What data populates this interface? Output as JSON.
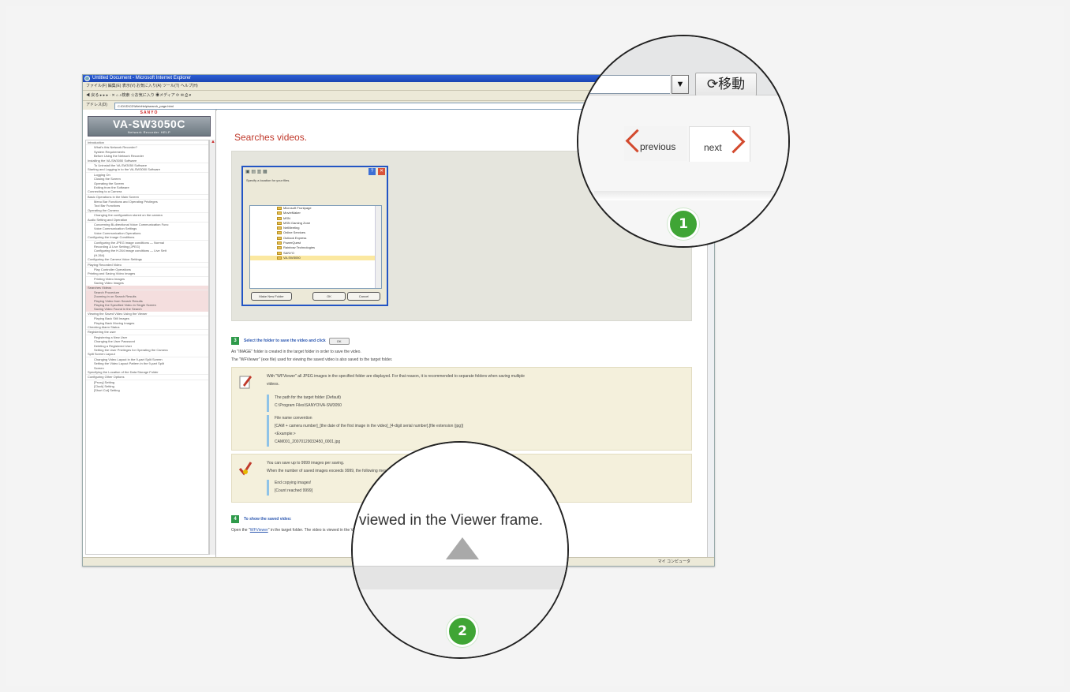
{
  "browser": {
    "title": "Untitled Document - Microsoft Internet Explorer",
    "menu": "ファイル(F)   編集(E)   表示(V)   お気に入り(A)   ツール(T)   ヘルプ(H)",
    "toolbar": "◀ 戻る ▸ ▸ ▸ · ✕ ⌂ ⌕検索 ☆お気に入り ◉メディア ⟳ ✉ ⎙ ▾",
    "address_label": "アドレス(D)",
    "address": "C:\\DVD\\CD\\WebHelp\\search_page.html",
    "status_zone": "マイ コンピュータ"
  },
  "sidebar": {
    "brand": "SANYO",
    "model": "VA-SW3050C",
    "model_sub": "Network Recorder HELP",
    "toc": [
      {
        "t": "Introduction",
        "level": 0
      },
      {
        "t": "What's this Network Recorder?",
        "level": 1
      },
      {
        "t": "System Requirements",
        "level": 1
      },
      {
        "t": "Before Using the Network Recorder",
        "level": 1
      },
      {
        "t": "Installing the VA-SW3050 Software",
        "level": 0
      },
      {
        "t": "To Uninstall the VA-SW3050 Software",
        "level": 1
      },
      {
        "t": "Starting and Logging in to the VA-SW3050 Software",
        "level": 0
      },
      {
        "t": "Logging On",
        "level": 1
      },
      {
        "t": "Closing the Screen",
        "level": 1
      },
      {
        "t": "Operating the Screen",
        "level": 1
      },
      {
        "t": "Exiting from the Software",
        "level": 1
      },
      {
        "t": "Connecting to a Camera",
        "level": 0
      },
      {
        "t": "Basic Operations in the Main Screen",
        "level": 0
      },
      {
        "t": "Menu Bar Functions and Operating Privileges",
        "level": 1
      },
      {
        "t": "Tool Bar Functions",
        "level": 1
      },
      {
        "t": "Operating the Camera",
        "level": 0
      },
      {
        "t": "Changing the configuration stored on the camera",
        "level": 1
      },
      {
        "t": "Audio Setting and Operation",
        "level": 0
      },
      {
        "t": "Concerning Bi-directional Voice Communication Func",
        "level": 1
      },
      {
        "t": "Voice Communication Settings",
        "level": 1
      },
      {
        "t": "Voice Communication Operations",
        "level": 1
      },
      {
        "t": "Configuring the Image Conditions",
        "level": 0
      },
      {
        "t": "Configuring the JPEG image conditions — Normal",
        "level": 1
      },
      {
        "t": "Recording & Live Setting (JPEG)",
        "level": 1
      },
      {
        "t": "Configuring the H.264 image conditions — Live Sett",
        "level": 1
      },
      {
        "t": "(H.264)",
        "level": 1
      },
      {
        "t": "Configuring the Camera Voice Settings",
        "level": 0
      },
      {
        "t": "Playing Recorded Video",
        "level": 0
      },
      {
        "t": "Play Controller Operations",
        "level": 1
      },
      {
        "t": "Printing and Saving Video Images",
        "level": 0
      },
      {
        "t": "Printing Video Images",
        "level": 1
      },
      {
        "t": "Saving Video Images",
        "level": 1
      },
      {
        "t": "Searches Videos",
        "level": 0,
        "hl": true
      },
      {
        "t": "Search Procedure",
        "level": 1,
        "hl": true
      },
      {
        "t": "Zooming in on Search Results",
        "level": 1,
        "hl": true
      },
      {
        "t": "Playing Video from Search Results",
        "level": 1,
        "hl": true
      },
      {
        "t": "Playing the Specified Video in Single Screen",
        "level": 1,
        "hl": true
      },
      {
        "t": "Saving Video Found in the Search",
        "level": 1,
        "hl": true
      },
      {
        "t": "Viewing the Saved Video Using the Viewer",
        "level": 0
      },
      {
        "t": "Playing Back Still Images",
        "level": 1
      },
      {
        "t": "Playing Back Moving Images",
        "level": 1
      },
      {
        "t": "Checking Alarm Status",
        "level": 0
      },
      {
        "t": "Registering the user",
        "level": 0
      },
      {
        "t": "Registering a New User",
        "level": 1
      },
      {
        "t": "Changing the User Password",
        "level": 1
      },
      {
        "t": "Deleting a Registered User",
        "level": 1
      },
      {
        "t": "Setting the User Privileges for Operating the Camera",
        "level": 1
      },
      {
        "t": "Split Screen Layout",
        "level": 0
      },
      {
        "t": "Changing Video Layout in the 9-part Split Screen",
        "level": 1
      },
      {
        "t": "Setting the Video Layout Pattern in the 9-part Split",
        "level": 1
      },
      {
        "t": "Screen",
        "level": 1
      },
      {
        "t": "Specifying the Location of the Data Storage Folder",
        "level": 0
      },
      {
        "t": "Configuring Other Options",
        "level": 0
      },
      {
        "t": "[Proxy] Setting",
        "level": 1
      },
      {
        "t": "[Clock] Setting",
        "level": 1
      },
      {
        "t": "[Short Cut] Setting",
        "level": 1
      }
    ]
  },
  "main": {
    "heading": "Searches videos.",
    "dialog": {
      "prompt": "Specify a location for your files.",
      "folders": [
        "Microsoft Frontpage",
        "MovieMaker",
        "MSN",
        "MSN Gaming Zone",
        "NetMeeting",
        "Online Services",
        "Outlook Express",
        "PowerQuest",
        "Rainbow Technologies",
        "SANYO",
        "VA-SW3050"
      ],
      "make_folder": "Make New Folder",
      "ok": "OK",
      "cancel": "Cancel"
    },
    "step3": {
      "num": "3",
      "title": "Select the folder to save the video and click",
      "btn": "OK"
    },
    "line1": "An \"IMAGE\" folder is created in the target folder in order to save the video.",
    "line2": "The \"WFViewer\" (exe file) used for viewing the saved video is also saved to the target folder.",
    "note1": {
      "text1": "With \"WFViewer\" all JPEG images in the specified folder are displayed. For that reason, it is recommended to separate folders when saving multiple",
      "text2": "videos.",
      "b1a": "The path for the target folder (Default)",
      "b1b": "C:\\Program Files\\SANYO\\VA-SW3050",
      "b2a": "File name convention",
      "b2b": "[CAM + camera number]_[the date of the first image in the video]_[4-digit serial number].[file extension (jpg)]",
      "b2c": "<Example:>",
      "b2d": "CAM001_20070129033450_0001.jpg"
    },
    "note2": {
      "text1": "You can save up to 9999 images per saving.",
      "text2": "When the number of saved images exceeds 9999, the following message appears to stop the saving operation.",
      "m1": "End copying images!",
      "m2": "[Count reached 9999]"
    },
    "step4": {
      "num": "4",
      "title": "To show the saved video:"
    },
    "line3_pre": "Open the \"",
    "line3_link": "WFViewer",
    "line3_post": "\" in the target folder. The video is viewed in the Viewer frame."
  },
  "magnifier1": {
    "go_label": "⟳移動",
    "previous": "previous",
    "next": "next"
  },
  "magnifier2": {
    "text": "viewed in the Viewer frame."
  },
  "badges": {
    "one": "1",
    "two": "2"
  },
  "colors": {
    "accent_red": "#d34a2e",
    "badge_green": "#3fa535",
    "link_blue": "#2b57b0"
  }
}
